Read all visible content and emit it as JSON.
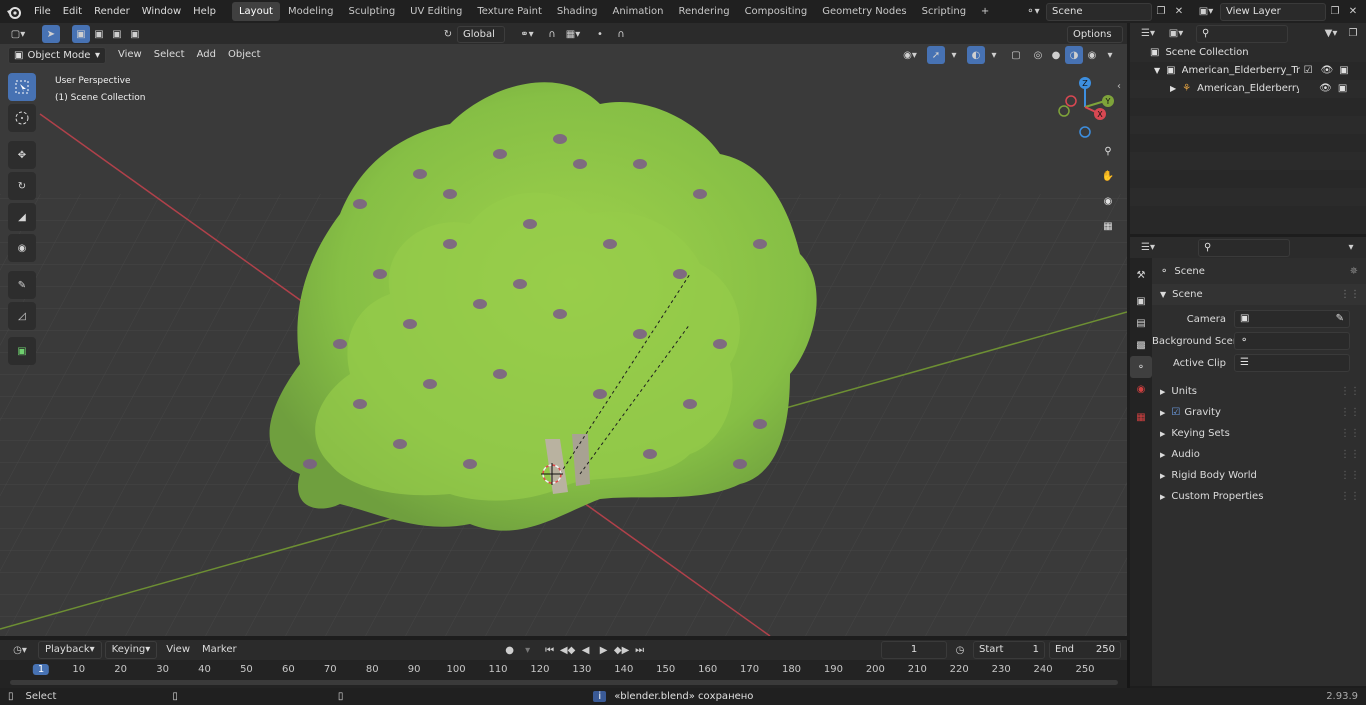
{
  "menu": [
    "File",
    "Edit",
    "Render",
    "Window",
    "Help"
  ],
  "workspaces": [
    "Layout",
    "Modeling",
    "Sculpting",
    "UV Editing",
    "Texture Paint",
    "Shading",
    "Animation",
    "Rendering",
    "Compositing",
    "Geometry Nodes",
    "Scripting"
  ],
  "scene_field": "Scene",
  "view_layer_field": "View Layer",
  "viewport_header": {
    "mode": "Object Mode",
    "menus": [
      "View",
      "Select",
      "Add",
      "Object"
    ],
    "orientation": "Global",
    "options": "Options"
  },
  "overlay": {
    "view_name": "User Perspective",
    "collection": "(1) Scene Collection"
  },
  "gizmo": {
    "z": "Z",
    "y": "Y",
    "x": "X"
  },
  "outliner": {
    "root": "Scene Collection",
    "items": [
      "American_Elderberry_Tree_w",
      "American_Elderberry_Tre"
    ]
  },
  "properties": {
    "context": "Scene",
    "panel": "Scene",
    "fields": [
      {
        "label": "Camera"
      },
      {
        "label": "Background Scene"
      },
      {
        "label": "Active Clip"
      }
    ],
    "subpanels": [
      "Units",
      "Gravity",
      "Keying Sets",
      "Audio",
      "Rigid Body World",
      "Custom Properties"
    ],
    "gravity_checked": true
  },
  "timeline": {
    "menus": [
      "Playback",
      "Keying",
      "View",
      "Marker"
    ],
    "current_frame": "1",
    "start_label": "Start",
    "start": "1",
    "end_label": "End",
    "end": "250",
    "ruler": [
      "1",
      "10",
      "20",
      "30",
      "40",
      "50",
      "60",
      "70",
      "80",
      "90",
      "100",
      "110",
      "120",
      "130",
      "140",
      "150",
      "160",
      "170",
      "180",
      "190",
      "200",
      "210",
      "220",
      "230",
      "240",
      "250"
    ]
  },
  "status": {
    "left": "Select",
    "message": "«blender.blend» сохранено",
    "version": "2.93.9"
  },
  "colors": {
    "accent": "#4772b3",
    "x_axis": "#d94852",
    "y_axis": "#7ea33a",
    "z_axis": "#3d8fe0",
    "foliage": "#8cc540"
  }
}
